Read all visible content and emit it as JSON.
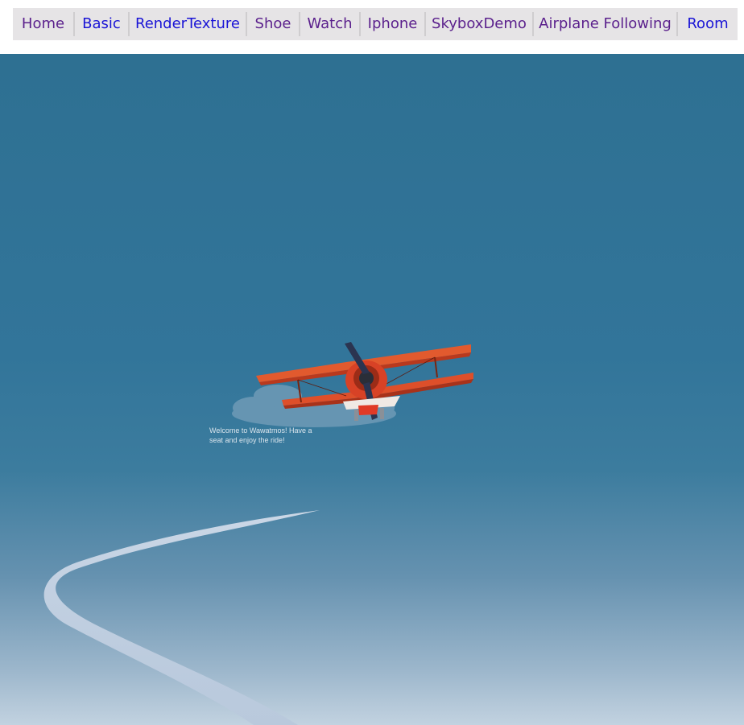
{
  "nav": {
    "items": [
      {
        "label": "Home",
        "visited": true
      },
      {
        "label": "Basic",
        "visited": false
      },
      {
        "label": "RenderTexture",
        "visited": false
      },
      {
        "label": "Shoe",
        "visited": true
      },
      {
        "label": "Watch",
        "visited": true
      },
      {
        "label": "Iphone",
        "visited": true
      },
      {
        "label": "SkyboxDemo",
        "visited": true
      },
      {
        "label": "Airplane Following",
        "visited": true
      },
      {
        "label": "Room",
        "visited": false
      }
    ]
  },
  "scene": {
    "welcome_text": "Welcome to Wawatmos! Have a seat and enjoy the ride!",
    "sky_colors": [
      "#2e7092",
      "#32759a",
      "#6692b0",
      "#c2d2e0"
    ],
    "plane_color": "#e0482a",
    "cloud_color": "#7fa8c2",
    "path_color": "#c8d4e6"
  }
}
